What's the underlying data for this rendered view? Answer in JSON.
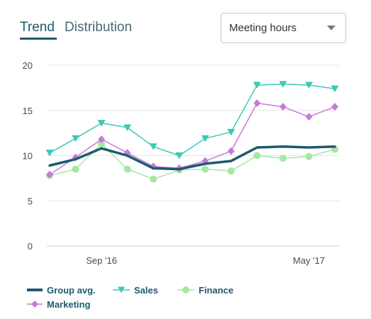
{
  "tabs": {
    "trend": "Trend",
    "distribution": "Distribution"
  },
  "dropdown": {
    "selected": "Meeting hours"
  },
  "colors": {
    "group_avg": "#1e5a6e",
    "sales": "#3cc9b5",
    "finance": "#a8e6a3",
    "marketing": "#c87ad8",
    "grid": "#e6e6e6",
    "axis": "#cccccc"
  },
  "legend": {
    "group_avg": "Group avg.",
    "sales": "Sales",
    "finance": "Finance",
    "marketing": "Marketing"
  },
  "chart_data": {
    "type": "line",
    "title": "",
    "xlabel": "",
    "ylabel": "",
    "ylim": [
      0,
      20
    ],
    "y_ticks": [
      0,
      5,
      10,
      15,
      20
    ],
    "x_tick_labels": [
      {
        "index": 2,
        "label": "Sep '16"
      },
      {
        "index": 10,
        "label": "May '17"
      }
    ],
    "x_count": 12,
    "grid": "horizontal",
    "legend_position": "bottom",
    "series": [
      {
        "name": "Group avg.",
        "marker": "none",
        "values": [
          8.9,
          9.6,
          10.8,
          10.0,
          8.6,
          8.5,
          9.1,
          9.4,
          10.9,
          11.0,
          10.9,
          11.0
        ]
      },
      {
        "name": "Sales",
        "marker": "triangle-down",
        "values": [
          10.3,
          11.9,
          13.6,
          13.1,
          11.0,
          10.0,
          11.9,
          12.6,
          17.8,
          17.9,
          17.8,
          17.4
        ]
      },
      {
        "name": "Finance",
        "marker": "circle",
        "values": [
          7.8,
          8.5,
          11.3,
          8.5,
          7.4,
          8.4,
          8.5,
          8.3,
          10.0,
          9.7,
          9.9,
          10.7
        ]
      },
      {
        "name": "Marketing",
        "marker": "diamond",
        "values": [
          7.9,
          9.8,
          11.8,
          10.3,
          8.8,
          8.6,
          9.4,
          10.5,
          15.8,
          15.4,
          14.3,
          15.4
        ]
      }
    ]
  }
}
